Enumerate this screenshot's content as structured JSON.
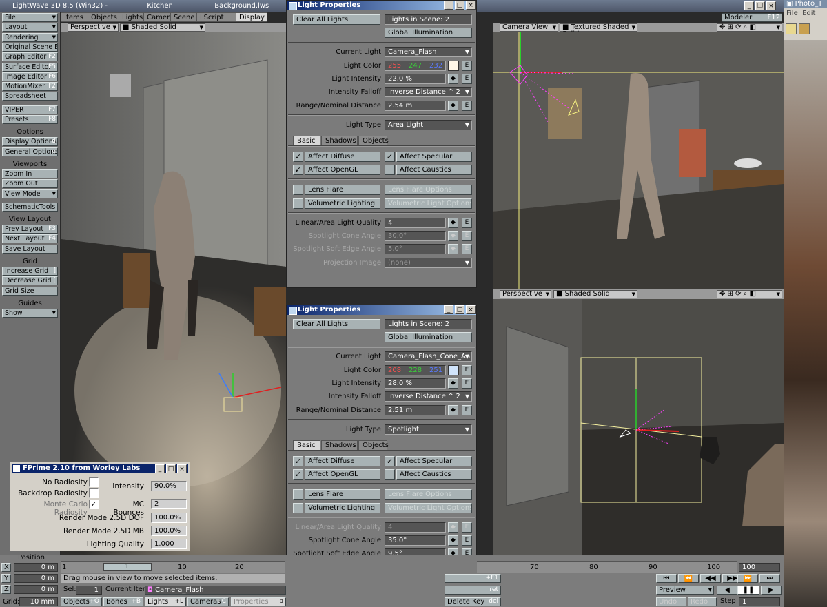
{
  "app": {
    "title": "LightWave 3D 8.5 (Win32) -",
    "scene_name": "Kitchen",
    "scene_file": "Background.lws",
    "modeler_label": "Modeler",
    "modeler_key": "F12"
  },
  "top_tabs": [
    "Items",
    "Objects",
    "Lights",
    "Camera",
    "Scene",
    "LScript",
    "Display"
  ],
  "left_toolbar": {
    "groups": [
      {
        "items": [
          {
            "label": "File",
            "dd": true
          },
          {
            "label": "Layout",
            "dd": true
          },
          {
            "label": "Rendering",
            "dd": true
          },
          {
            "label": "Original Scene E..."
          },
          {
            "label": "Graph Editor",
            "key": "F2"
          },
          {
            "label": "Surface Editor",
            "key": "F5"
          },
          {
            "label": "Image Editor",
            "key": "F6"
          },
          {
            "label": "MotionMixer",
            "key": "F2"
          },
          {
            "label": "Spreadsheet"
          }
        ]
      },
      {
        "items": [
          {
            "label": "VIPER",
            "key": "F7"
          },
          {
            "label": "Presets",
            "key": "F8"
          }
        ]
      },
      {
        "heading": "Options",
        "items": [
          {
            "label": "Display Options",
            "key": "d"
          },
          {
            "label": "General Options",
            "key": "o"
          }
        ]
      },
      {
        "heading": "Viewports",
        "items": [
          {
            "label": "Zoom In"
          },
          {
            "label": "Zoom Out"
          },
          {
            "label": "View Mode",
            "dd": true
          }
        ]
      },
      {
        "items": [
          {
            "label": "SchematicTools"
          }
        ]
      },
      {
        "heading": "View Layout",
        "items": [
          {
            "label": "Prev Layout",
            "key": "F3"
          },
          {
            "label": "Next Layout",
            "key": "F4"
          },
          {
            "label": "Save Layout"
          }
        ]
      },
      {
        "heading": "Grid",
        "items": [
          {
            "label": "Increase Grid",
            "key": "]"
          },
          {
            "label": "Decrease Grid",
            "key": "["
          },
          {
            "label": "Grid Size"
          }
        ]
      },
      {
        "heading": "Guides",
        "items": [
          {
            "label": "Show",
            "dd": true
          }
        ]
      }
    ]
  },
  "viewport_left": {
    "view": "Perspective",
    "mode": "Shaded Solid"
  },
  "viewport_top_right": {
    "view": "Camera View",
    "mode": "Textured Shaded Solid"
  },
  "viewport_bottom_right": {
    "view": "Perspective",
    "mode": "Shaded Solid"
  },
  "light_panel_1": {
    "title": "Light Properties",
    "clear_all": "Clear All Lights",
    "lights_in_scene": "Lights in Scene: 2",
    "global_illum": "Global Illumination",
    "current_light_label": "Current Light",
    "current_light": "Camera_Flash",
    "light_color_label": "Light Color",
    "color_r": "255",
    "color_g": "247",
    "color_b": "232",
    "swatch": "#fff7e8",
    "intensity_label": "Light Intensity",
    "intensity": "22.0 %",
    "falloff_label": "Intensity Falloff",
    "falloff": "Inverse Distance ^ 2",
    "range_label": "Range/Nominal Distance",
    "range": "2.54 m",
    "type_label": "Light Type",
    "type": "Area Light",
    "tabs": [
      "Basic",
      "Shadows",
      "Objects"
    ],
    "affect_diffuse": "Affect Diffuse",
    "affect_specular": "Affect Specular",
    "affect_opengl": "Affect OpenGL",
    "affect_caustics": "Affect Caustics",
    "lens_flare": "Lens Flare",
    "lens_flare_opts": "Lens Flare Options",
    "vol_light": "Volumetric Lighting",
    "vol_light_opts": "Volumetric Light Options",
    "quality_label": "Linear/Area Light Quality",
    "quality": "4",
    "cone_label": "Spotlight Cone Angle",
    "cone": "30.0°",
    "soft_label": "Spotlight Soft Edge Angle",
    "soft": "5.0°",
    "proj_label": "Projection Image",
    "proj": "(none)",
    "env_label": "E"
  },
  "light_panel_2": {
    "title": "Light Properties",
    "clear_all": "Clear All Lights",
    "lights_in_scene": "Lights in Scene: 2",
    "global_illum": "Global Illumination",
    "current_light_label": "Current Light",
    "current_light": "Camera_Flash_Cone_An",
    "light_color_label": "Light Color",
    "color_r": "208",
    "color_g": "228",
    "color_b": "251",
    "swatch": "#d0e4fb",
    "intensity_label": "Light Intensity",
    "intensity": "28.0 %",
    "falloff_label": "Intensity Falloff",
    "falloff": "Inverse Distance ^ 2",
    "range_label": "Range/Nominal Distance",
    "range": "2.51 m",
    "type_label": "Light Type",
    "type": "Spotlight",
    "tabs": [
      "Basic",
      "Shadows",
      "Objects"
    ],
    "affect_diffuse": "Affect Diffuse",
    "affect_specular": "Affect Specular",
    "affect_opengl": "Affect OpenGL",
    "affect_caustics": "Affect Caustics",
    "lens_flare": "Lens Flare",
    "lens_flare_opts": "Lens Flare Options",
    "vol_light": "Volumetric Lighting",
    "vol_light_opts": "Volumetric Light Options",
    "quality_label": "Linear/Area Light Quality",
    "quality": "4",
    "cone_label": "Spotlight Cone Angle",
    "cone": "35.0°",
    "soft_label": "Spotlight Soft Edge Angle",
    "soft": "9.5°",
    "proj_label": "Projection Image",
    "proj": "(none)",
    "env_label": "E"
  },
  "fprime": {
    "title": "FPrime 2.10 from Worley Labs",
    "no_radiosity": "No Radiosity",
    "backdrop_radiosity": "Backdrop Radiosity",
    "mc_radiosity": "Monte Carlo Radiosity",
    "intensity_label": "Intensity",
    "intensity": "90.0%",
    "mc_bounces_label": "MC Bounces",
    "mc_bounces": "2",
    "dof_label": "Render Mode 2.5D DOF",
    "dof": "100.0%",
    "mb_label": "Render Mode 2.5D MB",
    "mb": "100.0%",
    "quality_label": "Lighting Quality",
    "quality": "1.000"
  },
  "bottom": {
    "position_label": "Position",
    "x": "0 m",
    "y": "0 m",
    "z": "0 m",
    "grid_label": "Grid:",
    "grid": "10 mm",
    "timeline": [
      "1",
      "10",
      "20",
      "70",
      "80",
      "90",
      "100"
    ],
    "frame_current": "1",
    "frame_end": "100",
    "status": "Drag mouse in view to move selected items.",
    "sel_label": "Sel:",
    "sel": "1",
    "current_item_label": "Current Item",
    "current_item": "Camera_Flash",
    "objects": "Objects",
    "objects_key": "+O",
    "bones": "Bones",
    "bones_key": "+B",
    "lights": "Lights",
    "lights_key": "+L",
    "cameras": "Cameras",
    "cameras_key": "+C",
    "properties": "Properties",
    "properties_key": "p",
    "delete_key": "Delete Key",
    "delete_key_shortcut": "del",
    "plus_f1": "+F1",
    "ret": "ret",
    "preview": "Preview",
    "undo": "Undo",
    "redo": "Redo",
    "step_label": "Step",
    "step": "1"
  },
  "photoshop": {
    "title": "Photo_T",
    "menu": [
      "File",
      "Edit"
    ]
  }
}
